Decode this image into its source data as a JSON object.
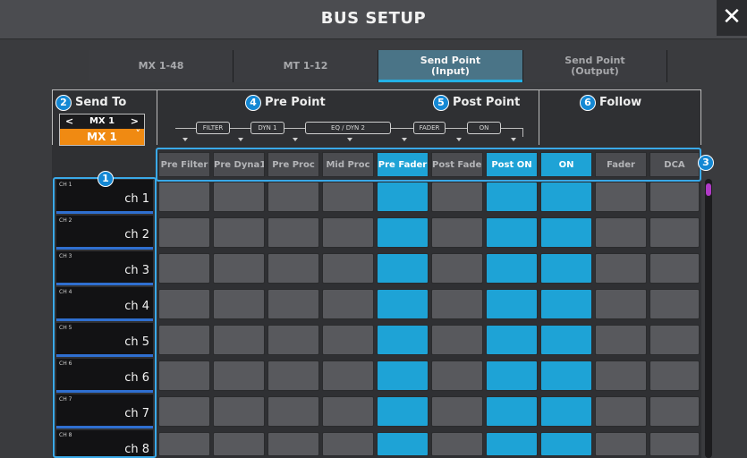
{
  "window": {
    "title": "BUS SETUP",
    "close_label": "✕"
  },
  "tabs": [
    {
      "label": "MX 1-48",
      "active": false
    },
    {
      "label": "MT 1-12",
      "active": false
    },
    {
      "label": "Send Point\n(Input)",
      "active": true
    },
    {
      "label": "Send Point\n(Output)",
      "active": false
    }
  ],
  "sections": {
    "send_to": {
      "badge": "2",
      "label": "Send To"
    },
    "pre_point": {
      "badge": "4",
      "label": "Pre Point"
    },
    "post_point": {
      "badge": "5",
      "label": "Post Point"
    },
    "follow": {
      "badge": "6",
      "label": "Follow"
    },
    "channels_badge": "1",
    "header_badge": "3"
  },
  "send_to": {
    "prev": "<",
    "next": ">",
    "current_small": "MX 1",
    "current": "MX 1",
    "chevron": "˅"
  },
  "flow": [
    "FILTER",
    "DYN 1",
    "EQ / DYN 2",
    "FADER",
    "ON"
  ],
  "header_buttons": [
    {
      "label": "Pre Filter",
      "on": false
    },
    {
      "label": "Pre Dyna1",
      "on": false
    },
    {
      "label": "Pre Proc",
      "on": false
    },
    {
      "label": "Mid Proc",
      "on": false
    },
    {
      "label": "Pre Fader",
      "on": true
    },
    {
      "label": "Post Fader",
      "on": false
    },
    {
      "label": "Post ON",
      "on": true
    },
    {
      "label": "ON",
      "on": true
    },
    {
      "label": "Fader",
      "on": false
    },
    {
      "label": "DCA",
      "on": false
    }
  ],
  "channels": [
    {
      "num": "CH 1",
      "name": "ch 1"
    },
    {
      "num": "CH 2",
      "name": "ch 2"
    },
    {
      "num": "CH 3",
      "name": "ch 3"
    },
    {
      "num": "CH 4",
      "name": "ch 4"
    },
    {
      "num": "CH 5",
      "name": "ch 5"
    },
    {
      "num": "CH 6",
      "name": "ch 6"
    },
    {
      "num": "CH 7",
      "name": "ch 7"
    },
    {
      "num": "CH 8",
      "name": "ch 8"
    }
  ],
  "grid_on_columns": [
    4,
    6,
    7
  ],
  "colors": {
    "accent": "#1ea3d6",
    "send_to": "#f08a12",
    "highlight": "#3aa9e8",
    "channel_bar": "#2f6fd0"
  }
}
